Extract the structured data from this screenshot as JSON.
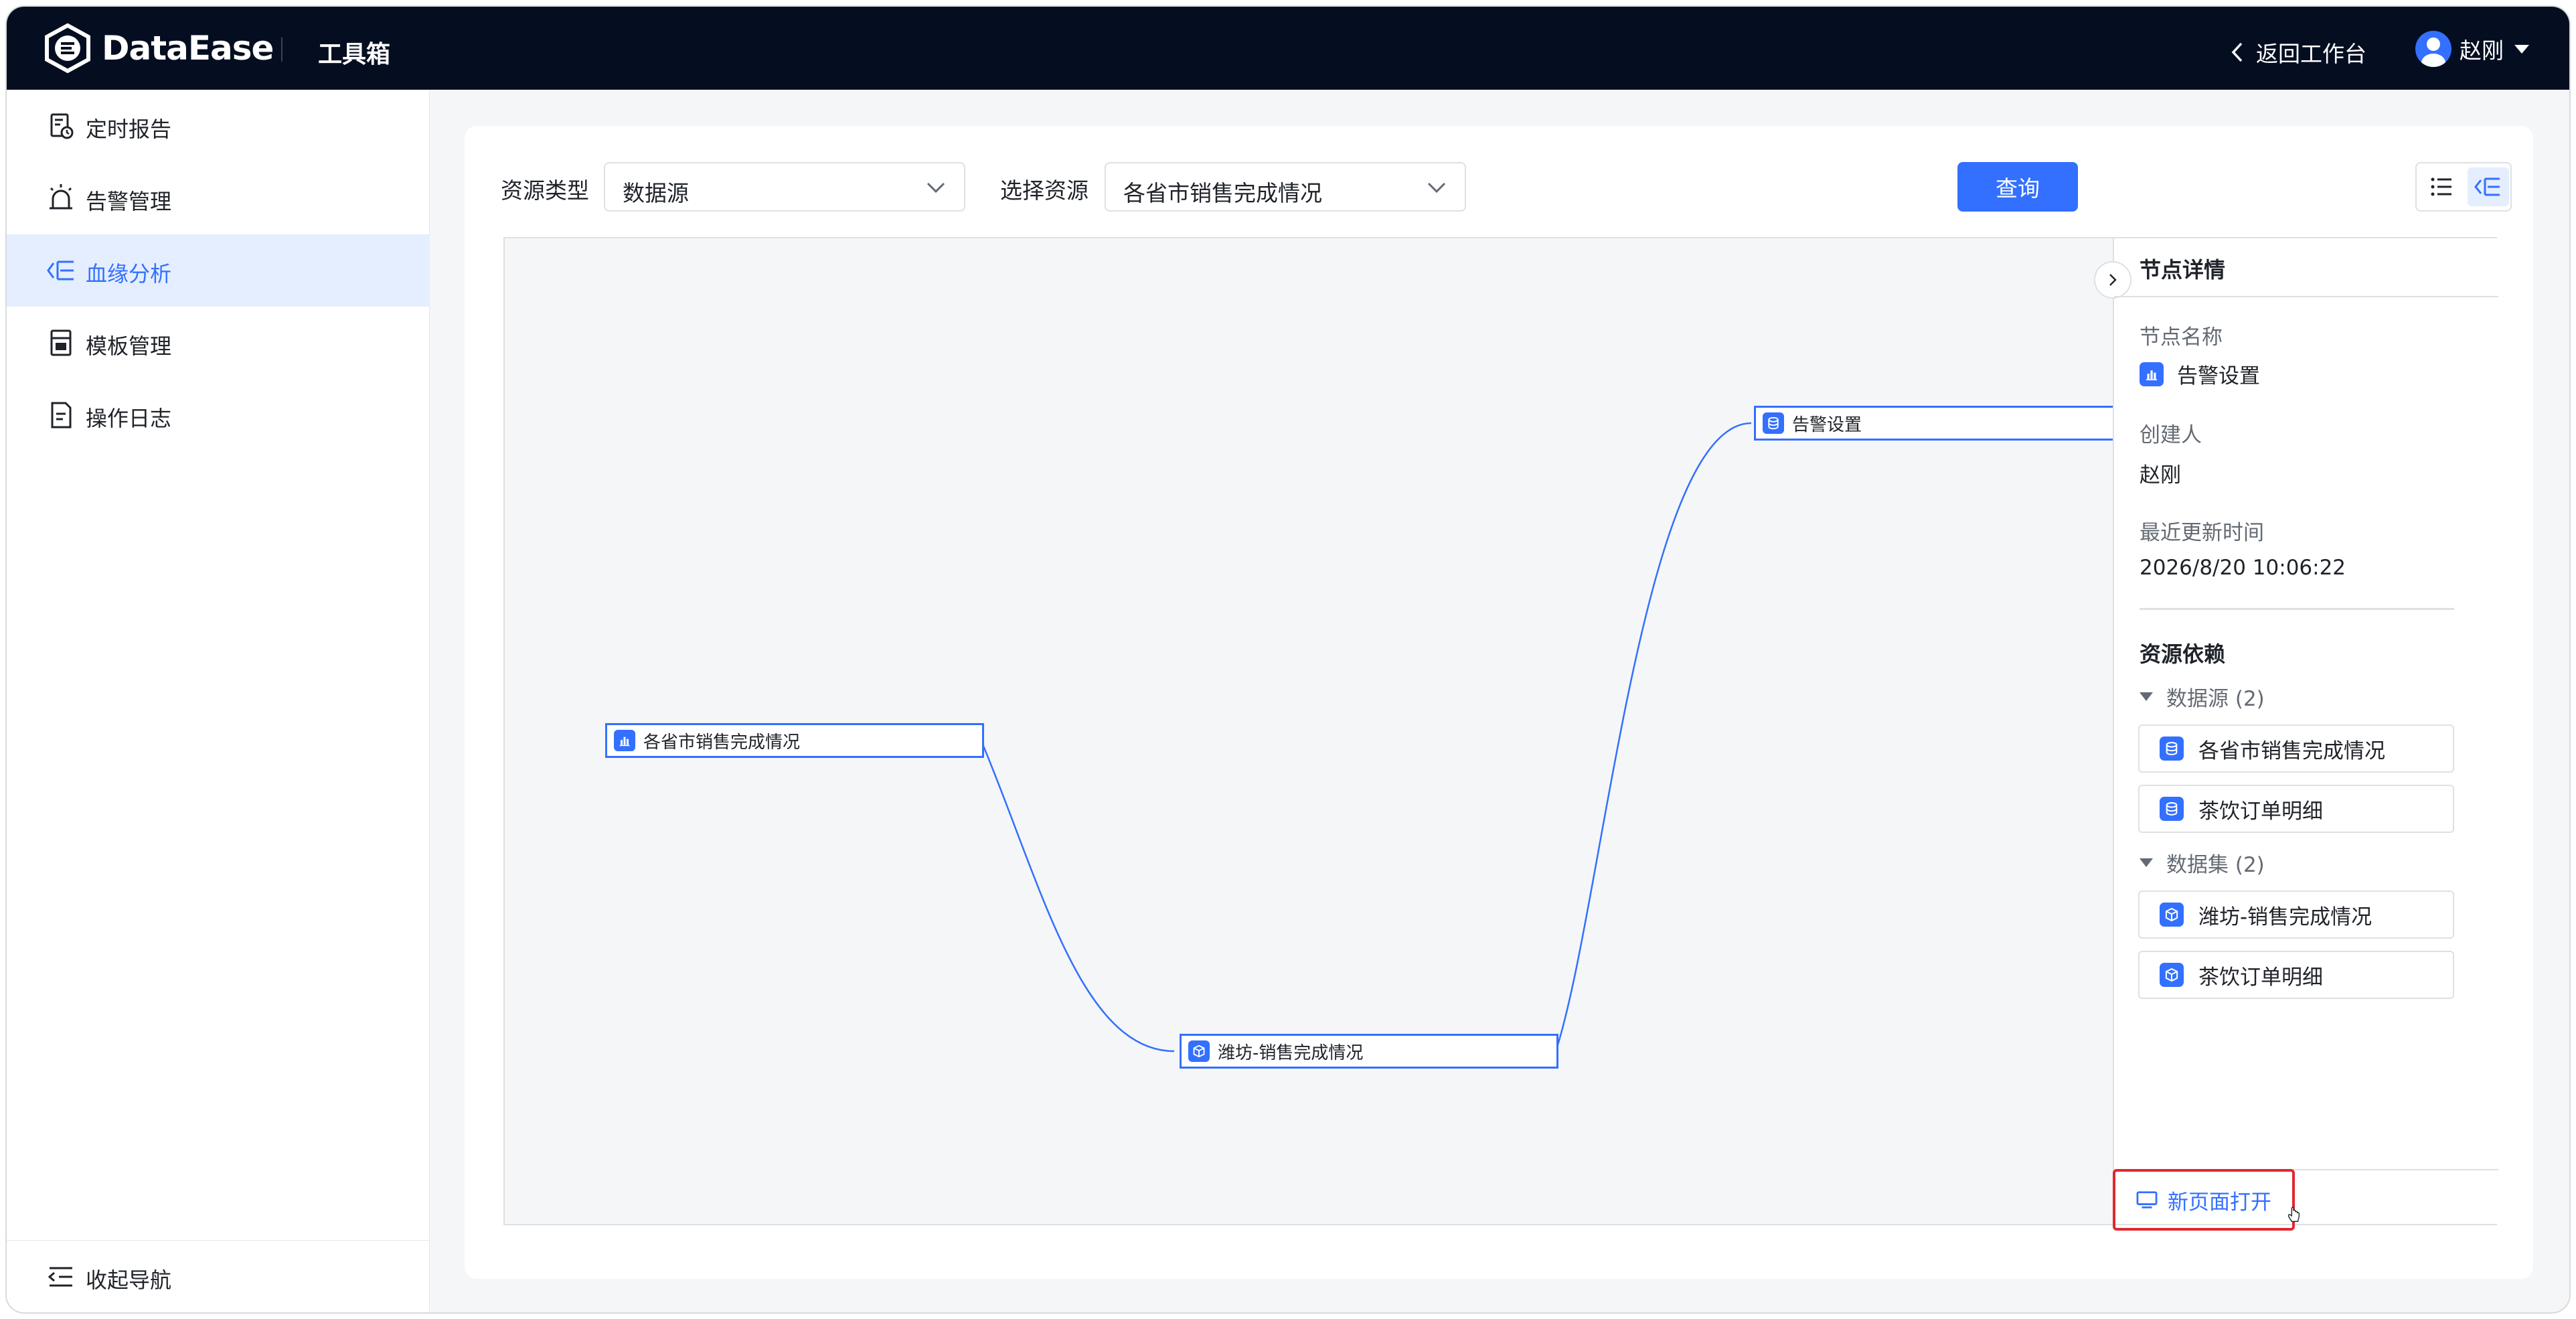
{
  "header": {
    "logo_text": "DataEase",
    "toolbox_title": "工具箱",
    "back_label": "返回工作台",
    "user_name": "赵刚"
  },
  "sidebar": {
    "items": [
      {
        "label": "定时报告",
        "icon": "scheduled-report-icon"
      },
      {
        "label": "告警管理",
        "icon": "alarm-icon"
      },
      {
        "label": "血缘分析",
        "icon": "lineage-icon",
        "active": true
      },
      {
        "label": "模板管理",
        "icon": "template-icon"
      },
      {
        "label": "操作日志",
        "icon": "log-icon"
      }
    ],
    "collapse_label": "收起导航"
  },
  "filters": {
    "resource_type_label": "资源类型",
    "resource_type_value": "数据源",
    "resource_label": "选择资源",
    "resource_value": "各省市销售完成情况",
    "query_label": "查询"
  },
  "graph": {
    "nodes": [
      {
        "id": "datasource",
        "label": "各省市销售完成情况",
        "icon": "chart-icon"
      },
      {
        "id": "dataset",
        "label": "潍坊-销售完成情况",
        "icon": "cube-icon"
      },
      {
        "id": "alarm",
        "label": "告警设置",
        "icon": "database-icon"
      }
    ],
    "edges": [
      [
        "datasource",
        "dataset"
      ],
      [
        "dataset",
        "alarm"
      ]
    ]
  },
  "detail": {
    "title": "节点详情",
    "name_label": "节点名称",
    "name_value": "告警设置",
    "creator_label": "创建人",
    "creator_value": "赵刚",
    "updated_label": "最近更新时间",
    "updated_value": "2026/8/20 10:06:22",
    "deps_title": "资源依赖",
    "groups": [
      {
        "title": "数据源 (2)",
        "items": [
          "各省市销售完成情况",
          "茶饮订单明细"
        ],
        "icon": "database-icon"
      },
      {
        "title": "数据集 (2)",
        "items": [
          "潍坊-销售完成情况",
          "茶饮订单明细"
        ],
        "icon": "cube-icon"
      }
    ],
    "open_new_label": "新页面打开"
  },
  "colors": {
    "accent": "#3370ff",
    "header_bg": "#050e21",
    "highlight": "#e0282e"
  }
}
